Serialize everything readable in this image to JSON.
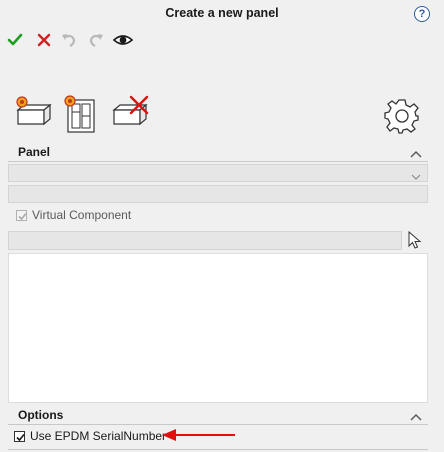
{
  "window": {
    "title": "Create a new panel",
    "help_glyph": "?"
  },
  "toolbar": {
    "buttons": [
      {
        "name": "ok-check-icon",
        "color": "#1e9e1e"
      },
      {
        "name": "cancel-x-icon",
        "color": "#d42020"
      },
      {
        "name": "undo-icon",
        "color": "#b8b8b8"
      },
      {
        "name": "redo-icon",
        "color": "#b8b8b8"
      },
      {
        "name": "preview-eye-icon",
        "color": "#1a1a1a"
      }
    ]
  },
  "actions": [
    {
      "name": "new-part-icon"
    },
    {
      "name": "new-assembly-icon"
    },
    {
      "name": "delete-part-icon"
    },
    {
      "name": "settings-gear-icon"
    }
  ],
  "panel_section": {
    "label": "Panel",
    "virtual_component_label": "Virtual Component",
    "virtual_component_checked": true,
    "virtual_component_enabled": false,
    "combo_value": "",
    "name_value": "",
    "selection_value": ""
  },
  "options_section": {
    "label": "Options",
    "use_epdm_label": "Use EPDM SerialNumber",
    "use_epdm_checked": true
  },
  "colors": {
    "accent_red": "#e01010",
    "field_gray": "#e6e6e6"
  }
}
